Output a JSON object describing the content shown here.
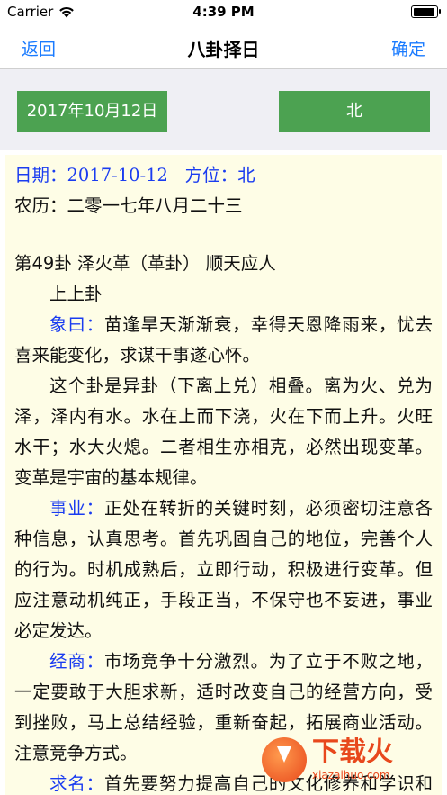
{
  "status_bar": {
    "carrier": "Carrier",
    "time": "4:39 PM",
    "battery_level": 0.92
  },
  "nav": {
    "back_label": "返回",
    "title": "八卦择日",
    "confirm_label": "确定"
  },
  "controls": {
    "date_button": "2017年10月12日",
    "direction_button": "北"
  },
  "content": {
    "date_label": "日期：",
    "date_value": "2017-10-12",
    "direction_label": "方位：",
    "direction_value": "北",
    "lunar": "农历：二零一七年八月二十三",
    "hexagram_title": "第49卦 泽火革（革卦） 顺天应人",
    "rank": "上上卦",
    "sections": [
      {
        "label": "象曰：",
        "text": "苗逢旱天渐渐衰，幸得天恩降雨来，忧去喜来能变化，求谋干事遂心怀。"
      },
      {
        "label": "",
        "text": "这个卦是异卦（下离上兑）相叠。离为火、兑为泽，泽内有水。水在上而下浇，火在下而上升。火旺水干；水大火熄。二者相生亦相克，必然出现变革。变革是宇宙的基本规律。"
      },
      {
        "label": "事业：",
        "text": "正处在转折的关键时刻，必须密切注意各种信息，认真思考。首先巩固自己的地位，完善个人的行为。时机成熟后，立即行动，积极进行变革。但应注意动机纯正，手段正当，不保守也不妄进，事业必定发达。"
      },
      {
        "label": "经商：",
        "text": "市场竞争十分激烈。为了立于不败之地，一定要敢于大胆求新，适时改变自己的经营方向，受到挫败，马上总结经验，重新奋起，拓展商业活动。注意竞争方式。"
      },
      {
        "label": "求名：",
        "text": "首先要努力提高自己的文化修养和学识和品德。同时，服从上级指示"
      }
    ]
  },
  "watermark": {
    "brand": "下载火",
    "domain": "xiazaihuo.com"
  },
  "colors": {
    "accent": "#1a7bff",
    "button_green": "#4ca251",
    "content_bg": "#fefde6",
    "label_blue": "#1a3cf0"
  }
}
